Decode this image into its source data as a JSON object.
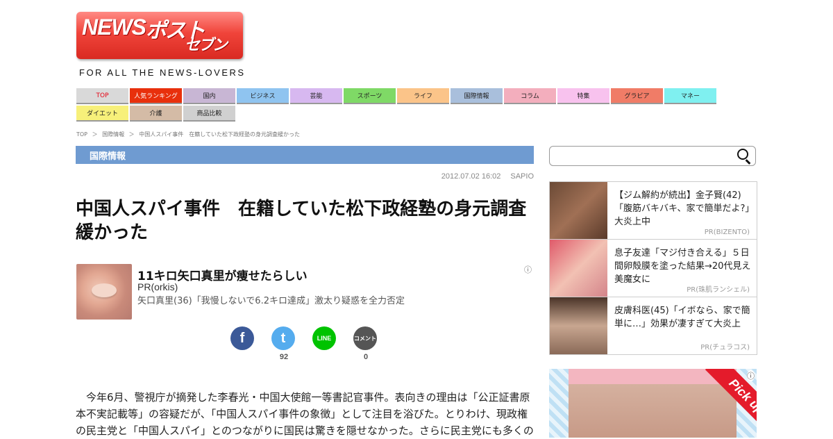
{
  "header": {
    "logo": {
      "news": "NEWS",
      "post": "ポスト",
      "seven": "セブン"
    },
    "tagline": "FOR ALL THE NEWS-LOVERS"
  },
  "nav": {
    "items": [
      {
        "label": "TOP",
        "color": "#d9d9d9",
        "text_color": "#e60012",
        "row": 1
      },
      {
        "label": "人気ランキング",
        "color": "#e8300c",
        "text_color": "#ffffff",
        "row": 1
      },
      {
        "label": "国内",
        "color": "#c8b6d4",
        "text_color": "#222222",
        "row": 1
      },
      {
        "label": "ビジネス",
        "color": "#8fc4f0",
        "text_color": "#222222",
        "row": 1
      },
      {
        "label": "芸能",
        "color": "#d7b8f0",
        "text_color": "#222222",
        "row": 1
      },
      {
        "label": "スポーツ",
        "color": "#7fd966",
        "text_color": "#222222",
        "row": 1
      },
      {
        "label": "ライフ",
        "color": "#fbc489",
        "text_color": "#222222",
        "row": 1
      },
      {
        "label": "国際情報",
        "color": "#a9bfdc",
        "text_color": "#222222",
        "row": 1
      },
      {
        "label": "コラム",
        "color": "#f3aebd",
        "text_color": "#222222",
        "row": 1
      },
      {
        "label": "特集",
        "color": "#f8c2ee",
        "text_color": "#222222",
        "row": 1
      },
      {
        "label": "グラビア",
        "color": "#f07c67",
        "text_color": "#222222",
        "row": 1
      },
      {
        "label": "マネー",
        "color": "#7ff0f0",
        "text_color": "#222222",
        "row": 1
      },
      {
        "label": "ダイエット",
        "color": "#f7f07a",
        "text_color": "#222222",
        "row": 2
      },
      {
        "label": "介護",
        "color": "#d4bba6",
        "text_color": "#222222",
        "row": 2
      },
      {
        "label": "商品比較",
        "color": "#d0d0d0",
        "text_color": "#222222",
        "row": 2
      }
    ]
  },
  "breadcrumb": [
    "TOP",
    "＞",
    "国際情報",
    "＞",
    "中国人スパイ事件　在籍していた松下政経塾の身元調査緩かった"
  ],
  "category": "国際情報",
  "article": {
    "date": "2012.07.02 16:02",
    "source": "SAPIO",
    "title": "中国人スパイ事件　在籍していた松下政経塾の身元調査緩かった",
    "body": "　今年6月、警視庁が摘発した李春光・中国大使館一等書記官事件。表向きの理由は「公正証書原本不実記載等」の容疑だが、「中国人スパイ事件の象徴」として注目を浴びた。とりわけ、現政権の民主党と「中国人スパイ」とのつながりに国民は驚きを隠せなかった。さらに民主党にも多くの"
  },
  "inline_ad": {
    "title": "11キロ矢口真里が痩せたらしい",
    "sponsor": "PR(orkis)",
    "description": "矢口真里(36)「我慢しないで6.2キロ達成」激太り疑惑を全力否定",
    "info_icon": "info-icon"
  },
  "share": [
    {
      "name": "facebook",
      "glyph": "f",
      "color": "#3b5998",
      "count": ""
    },
    {
      "name": "twitter",
      "glyph": "t",
      "color": "#55acee",
      "count": "92"
    },
    {
      "name": "line",
      "glyph": "LINE",
      "color": "#00c300",
      "count": ""
    },
    {
      "name": "comment",
      "glyph": "コメント",
      "color": "#555555",
      "count": "0"
    }
  ],
  "sidebar": {
    "search_placeholder": "",
    "pr_cards": [
      {
        "text": "【ジム解約が続出】金子賢(42)「腹筋バキバキ、家で簡単だよ?」大炎上中",
        "source": "PR(BIZENTO)",
        "img_color": "#8a5a3c"
      },
      {
        "text": "息子友達「マジ付き合える」５日間卵殻膜を塗った結果→20代見え美魔女に",
        "source": "PR(珠肌ランシェル)",
        "img_color": "#e05a6a"
      },
      {
        "text": "皮膚科医(45)「イボなら、家で簡単に…」効果が凄すぎて大炎上",
        "source": "PR(チュラコス)",
        "img_color": "#b08a70"
      }
    ],
    "pickup_label": "Pick up"
  }
}
